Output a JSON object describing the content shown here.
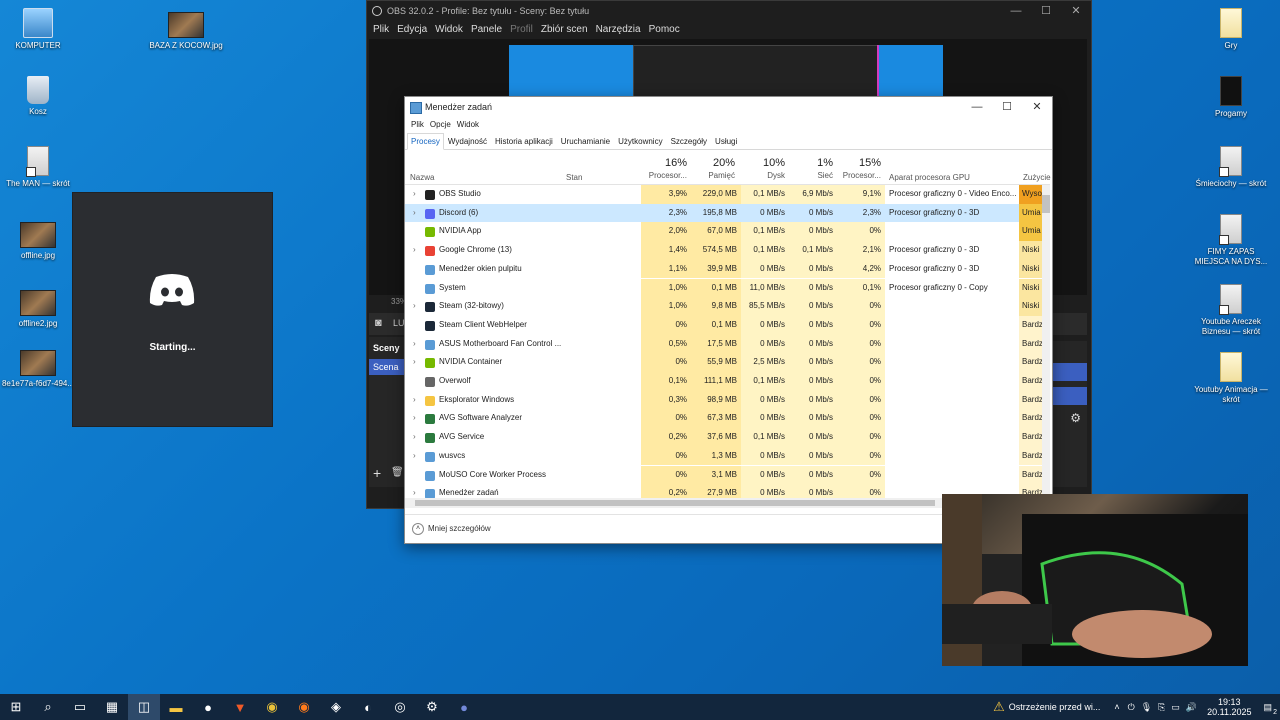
{
  "desktop": {
    "left_icons": [
      {
        "label": "KOMPUTER",
        "icon": "computer-icon"
      },
      {
        "label": "BAZA Z KOCOW.jpg",
        "icon": "photo-icon"
      },
      {
        "label": "Kosz",
        "icon": "recycle-bin-icon"
      },
      {
        "label": "The MAN — skrót",
        "icon": "shortcut-icon"
      },
      {
        "label": "offline.jpg",
        "icon": "photo-icon"
      },
      {
        "label": "offline2.jpg",
        "icon": "photo-icon"
      },
      {
        "label": "8e1e77a-f6d7-494...",
        "icon": "photo-icon"
      }
    ],
    "right_icons": [
      {
        "label": "Gry",
        "icon": "folder-icon"
      },
      {
        "label": "Progamy",
        "icon": "folder-icon"
      },
      {
        "label": "Śmieciochy — skrót",
        "icon": "shortcut-icon"
      },
      {
        "label": "FIMY ZAPAS MIEJSCA NA DYS...",
        "icon": "shortcut-icon"
      },
      {
        "label": "Youtube Areczek Biznesu — skrót",
        "icon": "shortcut-icon"
      },
      {
        "label": "Youtuby Animacja — skrót",
        "icon": "folder-icon"
      }
    ]
  },
  "obs": {
    "title": "OBS 32.0.2 - Profile: Bez tytułu - Sceny: Bez tytułu",
    "menu": [
      "Plik",
      "Edycja",
      "Widok",
      "Panele",
      "Profil",
      "Zbiór scen",
      "Narzędzia",
      "Pomoc"
    ],
    "zoom": "33%",
    "sources_label": "LUM",
    "scenes_header": "Sceny",
    "scene_item": "Scena"
  },
  "discord": {
    "status": "Starting..."
  },
  "taskmgr": {
    "title": "Menedżer zadań",
    "menu": [
      "Plik",
      "Opcje",
      "Widok"
    ],
    "tabs": [
      "Procesy",
      "Wydajność",
      "Historia aplikacji",
      "Uruchamianie",
      "Użytkownicy",
      "Szczegóły",
      "Usługi"
    ],
    "headers": {
      "name": "Nazwa",
      "status": "Stan",
      "cpu_pct": "16%",
      "cpu": "Procesor...",
      "mem_pct": "20%",
      "mem": "Pamięć",
      "disk_pct": "10%",
      "disk": "Dysk",
      "net_pct": "1%",
      "net": "Sieć",
      "gpu_pct": "15%",
      "gpu": "Procesor...",
      "gpu_engine": "Aparat procesora GPU",
      "power": "Zużycie"
    },
    "rows": [
      {
        "name": "OBS Studio",
        "exp": "›",
        "cpu": "3,9%",
        "mem": "229,0 MB",
        "disk": "0,1 MB/s",
        "net": "6,9 Mb/s",
        "gpu": "9,1%",
        "engine": "Procesor graficzny 0 - Video Enco...",
        "power": "Wysok",
        "icon": "obs-icon"
      },
      {
        "name": "Discord (6)",
        "exp": "›",
        "cpu": "2,3%",
        "mem": "195,8 MB",
        "disk": "0 MB/s",
        "net": "0 Mb/s",
        "gpu": "2,3%",
        "engine": "Procesor graficzny 0 - 3D",
        "power": "Umia",
        "icon": "discord-icon"
      },
      {
        "name": "NVIDIA App",
        "exp": "",
        "cpu": "2,0%",
        "mem": "67,0 MB",
        "disk": "0,1 MB/s",
        "net": "0 Mb/s",
        "gpu": "0%",
        "engine": "",
        "power": "Umia",
        "icon": "nvidia-icon"
      },
      {
        "name": "Google Chrome (13)",
        "exp": "›",
        "cpu": "1,4%",
        "mem": "574,5 MB",
        "disk": "0,1 MB/s",
        "net": "0,1 Mb/s",
        "gpu": "2,1%",
        "engine": "Procesor graficzny 0 - 3D",
        "power": "Niski",
        "icon": "chrome-icon"
      },
      {
        "name": "Menedżer okien pulpitu",
        "exp": "",
        "cpu": "1,1%",
        "mem": "39,9 MB",
        "disk": "0 MB/s",
        "net": "0 Mb/s",
        "gpu": "4,2%",
        "engine": "Procesor graficzny 0 - 3D",
        "power": "Niski",
        "icon": "window-icon"
      },
      {
        "name": "System",
        "exp": "",
        "cpu": "1,0%",
        "mem": "0,1 MB",
        "disk": "11,0 MB/s",
        "net": "0 Mb/s",
        "gpu": "0,1%",
        "engine": "Procesor graficzny 0 - Copy",
        "power": "Niski",
        "icon": "window-icon"
      },
      {
        "name": "Steam (32-bitowy)",
        "exp": "›",
        "cpu": "1,0%",
        "mem": "9,8 MB",
        "disk": "85,5 MB/s",
        "net": "0 Mb/s",
        "gpu": "0%",
        "engine": "",
        "power": "Niski",
        "icon": "steam-icon"
      },
      {
        "name": "Steam Client WebHelper",
        "exp": "",
        "cpu": "0%",
        "mem": "0,1 MB",
        "disk": "0 MB/s",
        "net": "0 Mb/s",
        "gpu": "0%",
        "engine": "",
        "power": "Bardz",
        "icon": "steam-icon"
      },
      {
        "name": "ASUS Motherboard Fan Control ...",
        "exp": "›",
        "cpu": "0,5%",
        "mem": "17,5 MB",
        "disk": "0 MB/s",
        "net": "0 Mb/s",
        "gpu": "0%",
        "engine": "",
        "power": "Bardz",
        "icon": "window-icon"
      },
      {
        "name": "NVIDIA Container",
        "exp": "›",
        "cpu": "0%",
        "mem": "55,9 MB",
        "disk": "2,5 MB/s",
        "net": "0 Mb/s",
        "gpu": "0%",
        "engine": "",
        "power": "Bardz",
        "icon": "nvidia-icon"
      },
      {
        "name": "Overwolf",
        "exp": "",
        "cpu": "0,1%",
        "mem": "111,1 MB",
        "disk": "0,1 MB/s",
        "net": "0 Mb/s",
        "gpu": "0%",
        "engine": "",
        "power": "Bardz",
        "icon": "overwolf-icon"
      },
      {
        "name": "Eksplorator Windows",
        "exp": "›",
        "cpu": "0,3%",
        "mem": "98,9 MB",
        "disk": "0 MB/s",
        "net": "0 Mb/s",
        "gpu": "0%",
        "engine": "",
        "power": "Bardz",
        "icon": "folder-icon"
      },
      {
        "name": "AVG Software Analyzer",
        "exp": "›",
        "cpu": "0%",
        "mem": "67,3 MB",
        "disk": "0 MB/s",
        "net": "0 Mb/s",
        "gpu": "0%",
        "engine": "",
        "power": "Bardz",
        "icon": "avg-icon"
      },
      {
        "name": "AVG Service",
        "exp": "›",
        "cpu": "0,2%",
        "mem": "37,6 MB",
        "disk": "0,1 MB/s",
        "net": "0 Mb/s",
        "gpu": "0%",
        "engine": "",
        "power": "Bardz",
        "icon": "avg-icon"
      },
      {
        "name": "wusvcs",
        "exp": "›",
        "cpu": "0%",
        "mem": "1,3 MB",
        "disk": "0 MB/s",
        "net": "0 Mb/s",
        "gpu": "0%",
        "engine": "",
        "power": "Bardz",
        "icon": "window-icon"
      },
      {
        "name": "MoUSO Core Worker Process",
        "exp": "",
        "cpu": "0%",
        "mem": "3,1 MB",
        "disk": "0 MB/s",
        "net": "0 Mb/s",
        "gpu": "0%",
        "engine": "",
        "power": "Bardz",
        "icon": "window-icon"
      },
      {
        "name": "Menedżer zadań",
        "exp": "›",
        "cpu": "0,2%",
        "mem": "27,9 MB",
        "disk": "0 MB/s",
        "net": "0 Mb/s",
        "gpu": "0%",
        "engine": "",
        "power": "Bardz",
        "icon": "taskmgr-icon"
      }
    ],
    "footer": "Mniej szczegółów"
  },
  "taskbar": {
    "notification": "Ostrzeżenie przed wi...",
    "time": "19:13",
    "date": "20.11.2025",
    "notif_count": "2"
  },
  "colors": {
    "accent": "#1565c0",
    "obs_bg": "#1e1e1e",
    "discord_bg": "#2b2d31",
    "heat_low": "#fff4c4",
    "heat_mid": "#ffeaa3",
    "power_high": "#f0a020",
    "power_mid": "#f5c542"
  }
}
